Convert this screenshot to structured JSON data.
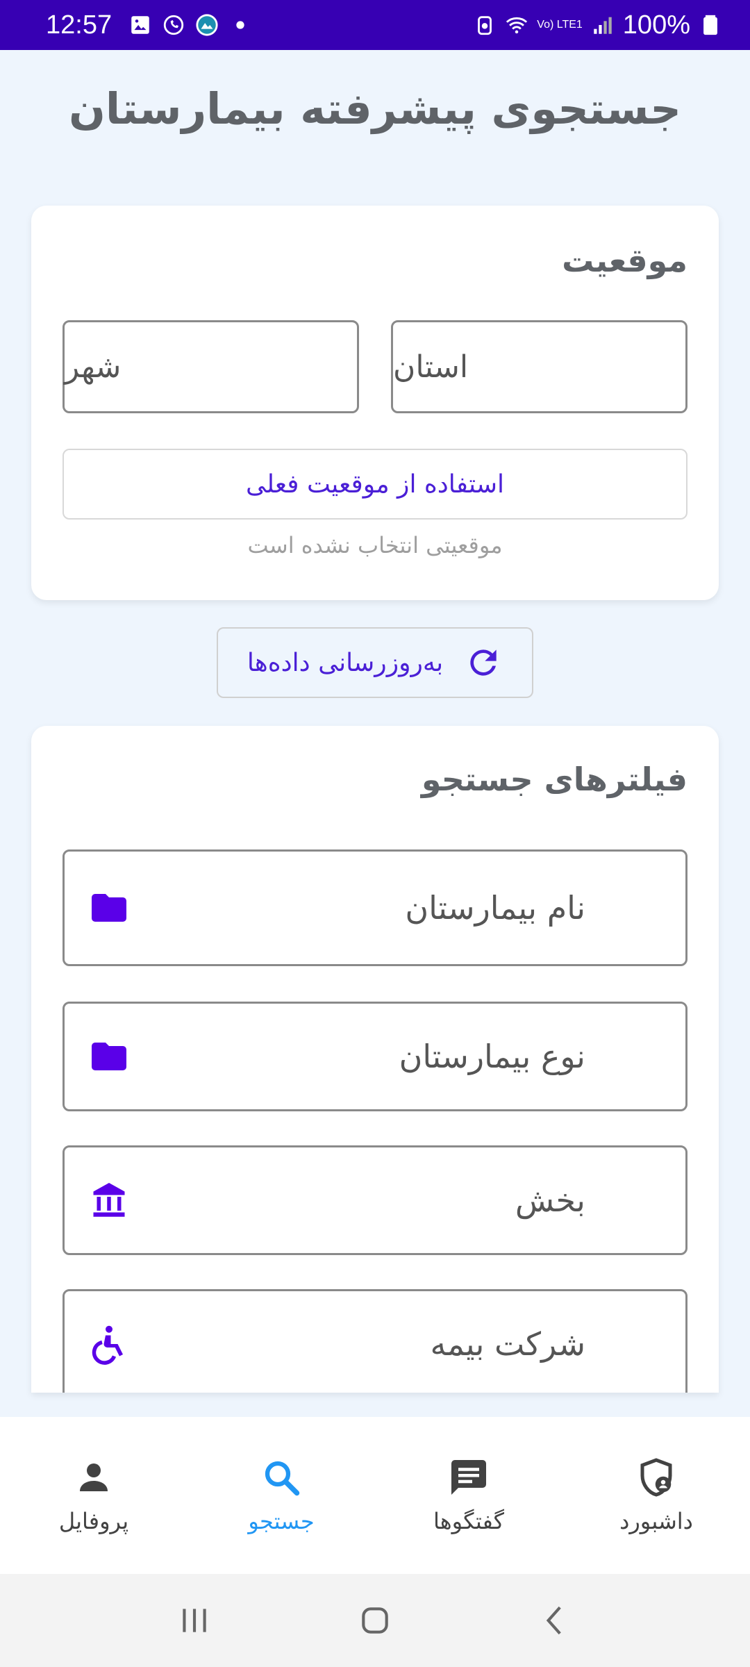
{
  "status_bar": {
    "time": "12:57",
    "battery": "100%",
    "network": "Vo) LTE1"
  },
  "page": {
    "title": "جستجوی پیشرفته بیمارستان"
  },
  "location": {
    "title": "موقعیت",
    "province_placeholder": "استان",
    "city_placeholder": "شهر",
    "current_location_label": "استفاده از موقعیت فعلی",
    "status": "موقعیتی انتخاب نشده است"
  },
  "refresh": {
    "label": "به‌روزرسانی داده‌ها"
  },
  "filters": {
    "title": "فیلترهای جستجو",
    "items": [
      {
        "label": "نام بیمارستان",
        "icon": "folder-icon"
      },
      {
        "label": "نوع بیمارستان",
        "icon": "folder-icon"
      },
      {
        "label": "بخش",
        "icon": "institution-icon"
      },
      {
        "label": "شرکت بیمه",
        "icon": "accessibility-icon"
      }
    ]
  },
  "bottom_nav": {
    "items": [
      {
        "label": "داشبورد",
        "icon": "shield-user-icon"
      },
      {
        "label": "گفتگوها",
        "icon": "chat-icon"
      },
      {
        "label": "جستجو",
        "icon": "search-icon",
        "active": true
      },
      {
        "label": "پروفایل",
        "icon": "person-icon"
      }
    ]
  },
  "colors": {
    "status_bar": "#3700B3",
    "accent": "#4A1FD6",
    "nav_active": "#2196F3",
    "background": "#EEF5FD"
  }
}
